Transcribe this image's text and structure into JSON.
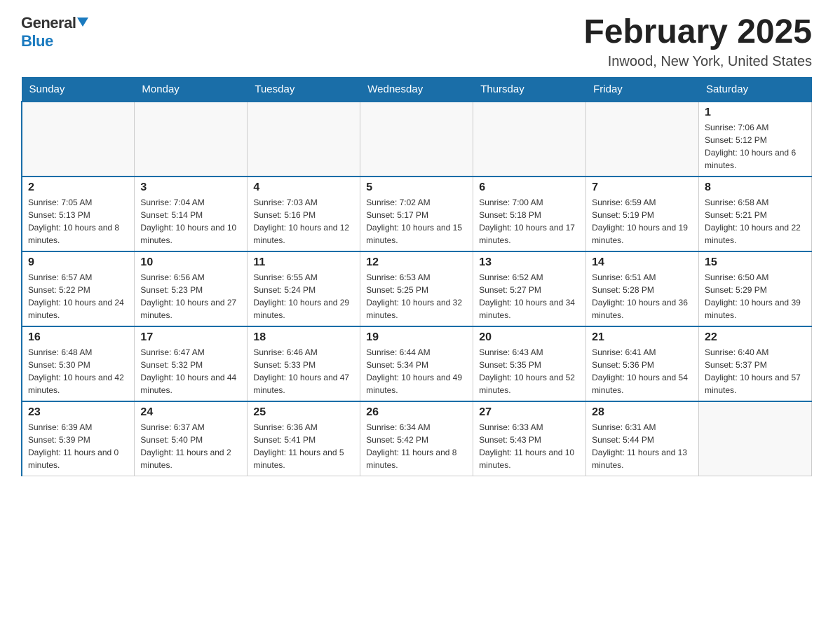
{
  "header": {
    "logo_general": "General",
    "logo_blue": "Blue",
    "month_title": "February 2025",
    "location": "Inwood, New York, United States"
  },
  "weekdays": [
    "Sunday",
    "Monday",
    "Tuesday",
    "Wednesday",
    "Thursday",
    "Friday",
    "Saturday"
  ],
  "weeks": [
    [
      {
        "day": "",
        "info": ""
      },
      {
        "day": "",
        "info": ""
      },
      {
        "day": "",
        "info": ""
      },
      {
        "day": "",
        "info": ""
      },
      {
        "day": "",
        "info": ""
      },
      {
        "day": "",
        "info": ""
      },
      {
        "day": "1",
        "info": "Sunrise: 7:06 AM\nSunset: 5:12 PM\nDaylight: 10 hours and 6 minutes."
      }
    ],
    [
      {
        "day": "2",
        "info": "Sunrise: 7:05 AM\nSunset: 5:13 PM\nDaylight: 10 hours and 8 minutes."
      },
      {
        "day": "3",
        "info": "Sunrise: 7:04 AM\nSunset: 5:14 PM\nDaylight: 10 hours and 10 minutes."
      },
      {
        "day": "4",
        "info": "Sunrise: 7:03 AM\nSunset: 5:16 PM\nDaylight: 10 hours and 12 minutes."
      },
      {
        "day": "5",
        "info": "Sunrise: 7:02 AM\nSunset: 5:17 PM\nDaylight: 10 hours and 15 minutes."
      },
      {
        "day": "6",
        "info": "Sunrise: 7:00 AM\nSunset: 5:18 PM\nDaylight: 10 hours and 17 minutes."
      },
      {
        "day": "7",
        "info": "Sunrise: 6:59 AM\nSunset: 5:19 PM\nDaylight: 10 hours and 19 minutes."
      },
      {
        "day": "8",
        "info": "Sunrise: 6:58 AM\nSunset: 5:21 PM\nDaylight: 10 hours and 22 minutes."
      }
    ],
    [
      {
        "day": "9",
        "info": "Sunrise: 6:57 AM\nSunset: 5:22 PM\nDaylight: 10 hours and 24 minutes."
      },
      {
        "day": "10",
        "info": "Sunrise: 6:56 AM\nSunset: 5:23 PM\nDaylight: 10 hours and 27 minutes."
      },
      {
        "day": "11",
        "info": "Sunrise: 6:55 AM\nSunset: 5:24 PM\nDaylight: 10 hours and 29 minutes."
      },
      {
        "day": "12",
        "info": "Sunrise: 6:53 AM\nSunset: 5:25 PM\nDaylight: 10 hours and 32 minutes."
      },
      {
        "day": "13",
        "info": "Sunrise: 6:52 AM\nSunset: 5:27 PM\nDaylight: 10 hours and 34 minutes."
      },
      {
        "day": "14",
        "info": "Sunrise: 6:51 AM\nSunset: 5:28 PM\nDaylight: 10 hours and 36 minutes."
      },
      {
        "day": "15",
        "info": "Sunrise: 6:50 AM\nSunset: 5:29 PM\nDaylight: 10 hours and 39 minutes."
      }
    ],
    [
      {
        "day": "16",
        "info": "Sunrise: 6:48 AM\nSunset: 5:30 PM\nDaylight: 10 hours and 42 minutes."
      },
      {
        "day": "17",
        "info": "Sunrise: 6:47 AM\nSunset: 5:32 PM\nDaylight: 10 hours and 44 minutes."
      },
      {
        "day": "18",
        "info": "Sunrise: 6:46 AM\nSunset: 5:33 PM\nDaylight: 10 hours and 47 minutes."
      },
      {
        "day": "19",
        "info": "Sunrise: 6:44 AM\nSunset: 5:34 PM\nDaylight: 10 hours and 49 minutes."
      },
      {
        "day": "20",
        "info": "Sunrise: 6:43 AM\nSunset: 5:35 PM\nDaylight: 10 hours and 52 minutes."
      },
      {
        "day": "21",
        "info": "Sunrise: 6:41 AM\nSunset: 5:36 PM\nDaylight: 10 hours and 54 minutes."
      },
      {
        "day": "22",
        "info": "Sunrise: 6:40 AM\nSunset: 5:37 PM\nDaylight: 10 hours and 57 minutes."
      }
    ],
    [
      {
        "day": "23",
        "info": "Sunrise: 6:39 AM\nSunset: 5:39 PM\nDaylight: 11 hours and 0 minutes."
      },
      {
        "day": "24",
        "info": "Sunrise: 6:37 AM\nSunset: 5:40 PM\nDaylight: 11 hours and 2 minutes."
      },
      {
        "day": "25",
        "info": "Sunrise: 6:36 AM\nSunset: 5:41 PM\nDaylight: 11 hours and 5 minutes."
      },
      {
        "day": "26",
        "info": "Sunrise: 6:34 AM\nSunset: 5:42 PM\nDaylight: 11 hours and 8 minutes."
      },
      {
        "day": "27",
        "info": "Sunrise: 6:33 AM\nSunset: 5:43 PM\nDaylight: 11 hours and 10 minutes."
      },
      {
        "day": "28",
        "info": "Sunrise: 6:31 AM\nSunset: 5:44 PM\nDaylight: 11 hours and 13 minutes."
      },
      {
        "day": "",
        "info": ""
      }
    ]
  ]
}
